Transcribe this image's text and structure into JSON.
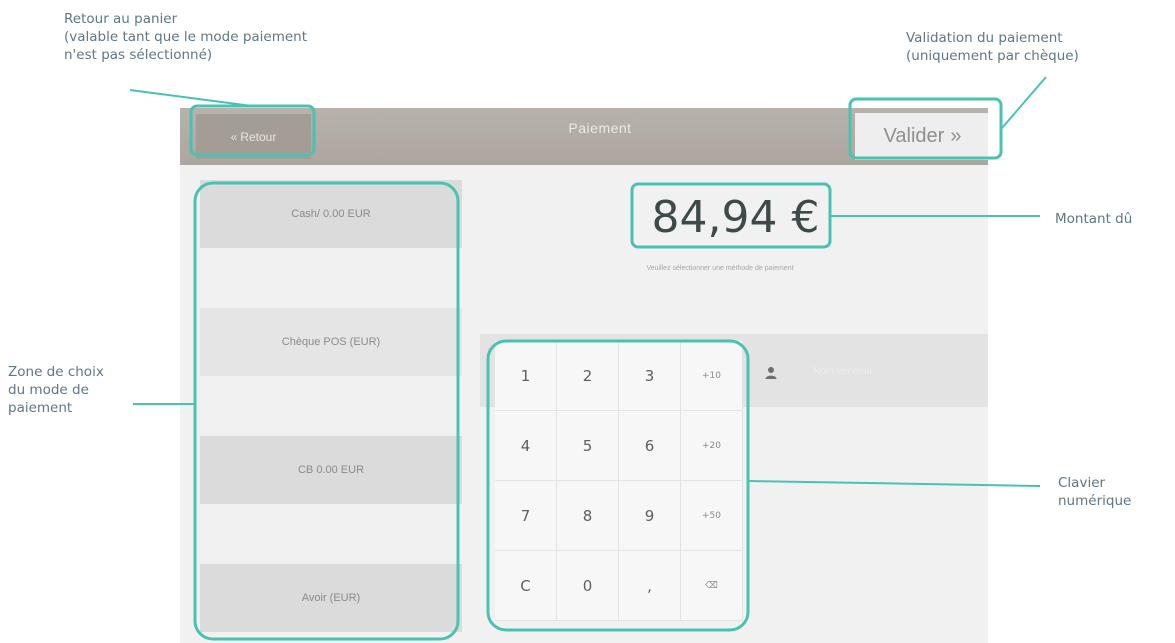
{
  "annotations": {
    "back": [
      "Retour au panier",
      "(valable tant que le mode paiement",
      "n'est pas sélectionné)"
    ],
    "validate": [
      "Validation du paiement",
      "(uniquement par chèque)"
    ],
    "amount": [
      "Montant dû"
    ],
    "methods": [
      "Zone de choix",
      "du mode de",
      "paiement"
    ],
    "keypad": [
      "Clavier",
      "numérique"
    ]
  },
  "topbar": {
    "back_label": "Retour",
    "title": "Paiement",
    "validate_label": "Valider"
  },
  "methods": [
    {
      "label": "Cash/ 0.00 EUR"
    },
    {
      "label": "Chèque POS (EUR)"
    },
    {
      "label": "CB 0.00 EUR"
    },
    {
      "label": "Avoir (EUR)"
    }
  ],
  "amount": {
    "value": "84,94 €",
    "hint": "Veuillez sélectionner une méthode de paiement"
  },
  "keypad": {
    "keys": [
      "1",
      "2",
      "3",
      "+10",
      "4",
      "5",
      "6",
      "+20",
      "7",
      "8",
      "9",
      "+50",
      "C",
      "0",
      ",",
      "⌫"
    ]
  },
  "cashier": {
    "name": "Nom vendeur"
  },
  "colors": {
    "callout": "#49c2b4",
    "annotation_text": "#5f7784",
    "topbar": "#b3ada6"
  },
  "icons": [
    "back-chevron-icon",
    "forward-chevron-icon",
    "user-icon",
    "backspace-icon"
  ]
}
